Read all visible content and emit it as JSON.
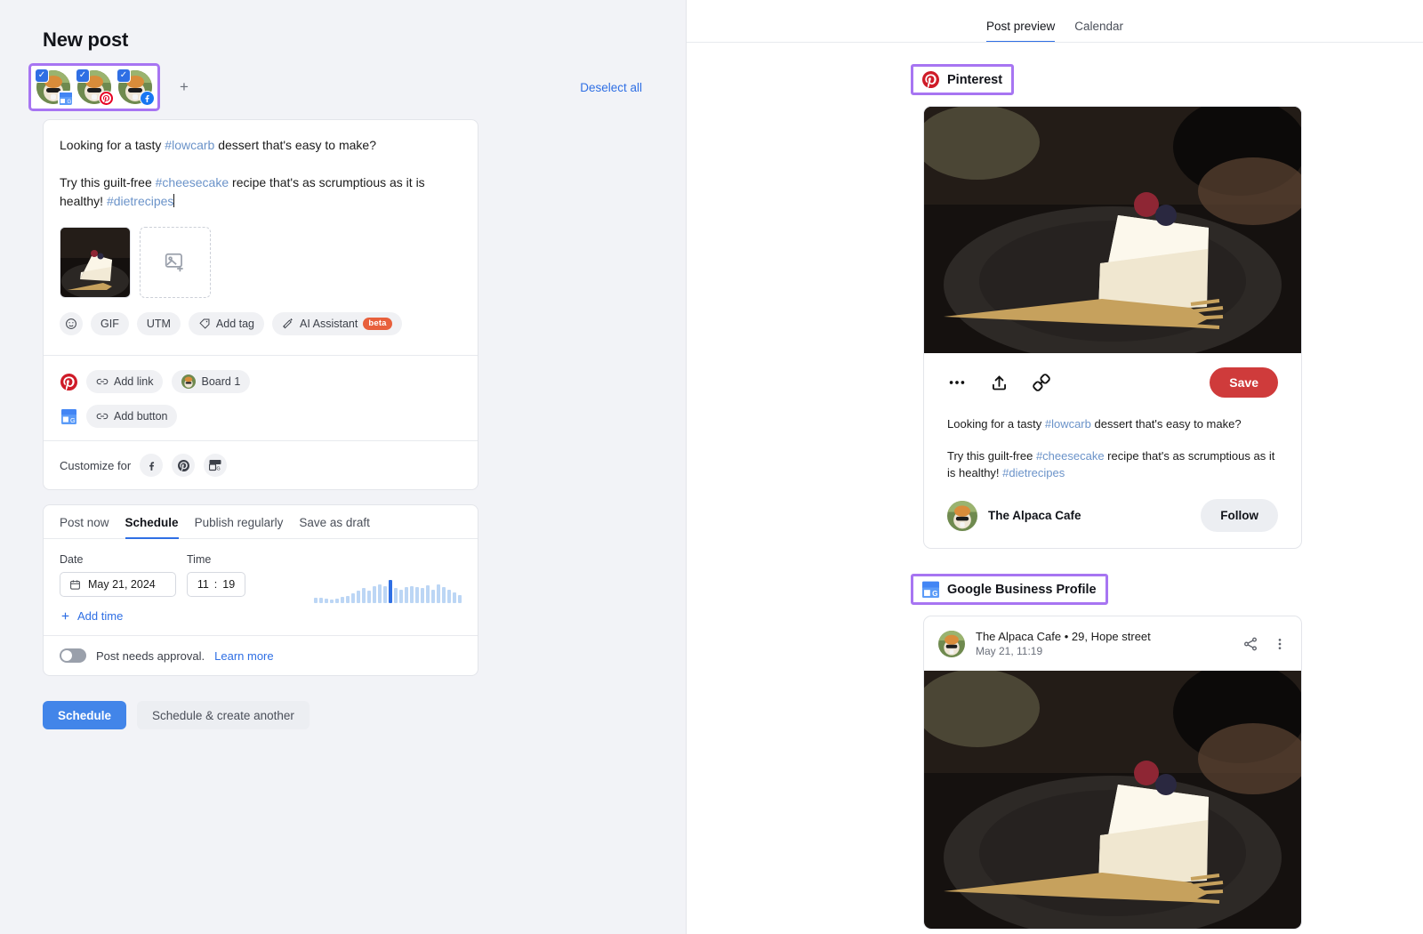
{
  "left": {
    "page_title": "New post",
    "accounts": [
      {
        "name": "The Alpaca Cafe",
        "network": "gbp",
        "selected": true
      },
      {
        "name": "The Alpaca Cafe",
        "network": "pinterest",
        "selected": true
      },
      {
        "name": "The Alpaca Cafe",
        "network": "facebook",
        "selected": true
      }
    ],
    "add_account_label": "+",
    "deselect_all_label": "Deselect all",
    "composer": {
      "paragraph_1_prefix": "Looking for a tasty ",
      "paragraph_1_tag": "#lowcarb",
      "paragraph_1_suffix": " dessert that's easy to make?",
      "paragraph_2_prefix": "Try this guilt-free ",
      "paragraph_2_tag": "#cheesecake",
      "paragraph_2_mid": " recipe that's as scrumptious as it is healthy! ",
      "paragraph_2_tag2": "#dietrecipes",
      "media_add_label": "add-image",
      "chips": [
        {
          "icon": "emoji-icon",
          "label": ""
        },
        {
          "icon": "",
          "label": "GIF"
        },
        {
          "icon": "",
          "label": "UTM"
        },
        {
          "icon": "tag-icon",
          "label": "Add tag"
        },
        {
          "icon": "sparkle-pen-icon",
          "label": "AI Assistant",
          "badge": "beta"
        }
      ]
    },
    "links": {
      "pinterest_add_link": "Add link",
      "pinterest_board": "Board 1",
      "gbp_add_button": "Add button"
    },
    "customize": {
      "label": "Customize for",
      "networks": [
        "facebook",
        "pinterest",
        "gbp"
      ]
    },
    "schedule": {
      "tabs": [
        {
          "label": "Post now",
          "active": false
        },
        {
          "label": "Schedule",
          "active": true
        },
        {
          "label": "Publish regularly",
          "active": false
        },
        {
          "label": "Save as draft",
          "active": false
        }
      ],
      "date_label": "Date",
      "time_label": "Time",
      "date_value": "May 21, 2024",
      "time_hour": "11",
      "time_sep": ":",
      "time_minute": "19",
      "add_time_label": "Add time",
      "approval_text": "Post needs approval.",
      "approval_link": "Learn more",
      "approval_enabled": false
    },
    "actions": {
      "primary": "Schedule",
      "secondary": "Schedule & create another"
    }
  },
  "right": {
    "tabs": [
      {
        "label": "Post preview",
        "active": true
      },
      {
        "label": "Calendar",
        "active": false
      }
    ],
    "pinterest": {
      "title": "Pinterest",
      "save_label": "Save",
      "text_1_prefix": "Looking for a tasty ",
      "text_1_tag": "#lowcarb",
      "text_1_suffix": " dessert that's easy to make?",
      "text_2_prefix": "Try this guilt-free ",
      "text_2_tag": "#cheesecake",
      "text_2_mid": " recipe that's as scrumptious as it is healthy! ",
      "text_2_tag2": "#dietrecipes",
      "username": "The Alpaca Cafe",
      "follow_label": "Follow"
    },
    "gbp": {
      "title": "Google Business Profile",
      "business_line": "The Alpaca Cafe • 29, Hope street",
      "timestamp": "May 21, 11:19"
    }
  },
  "colors": {
    "accent_blue": "#2f6fe4",
    "button_blue": "#4285e9",
    "highlight_purple": "#a775f2",
    "pinterest_red": "#e60023",
    "save_red": "#cf3b3b",
    "facebook_blue": "#1877f2",
    "beta_orange": "#e8603c",
    "left_bg": "#f2f3f7",
    "hashtag_blue": "#6b93c9"
  },
  "chart_data": {
    "type": "bar",
    "title": "Best time to post sparkline",
    "categories": [
      "0",
      "1",
      "2",
      "3",
      "4",
      "5",
      "6",
      "7",
      "8",
      "9",
      "10",
      "11",
      "12",
      "13",
      "14",
      "15",
      "16",
      "17",
      "18",
      "19",
      "20",
      "21",
      "22",
      "23",
      "24",
      "25",
      "26",
      "27"
    ],
    "values": [
      5,
      5,
      4,
      3,
      4,
      6,
      7,
      9,
      12,
      14,
      12,
      16,
      18,
      16,
      22,
      14,
      13,
      15,
      16,
      15,
      14,
      17,
      13,
      18,
      15,
      13,
      10,
      8
    ],
    "highlight_index": 14,
    "xlabel": "",
    "ylabel": "",
    "grid": false,
    "legend": "none"
  }
}
